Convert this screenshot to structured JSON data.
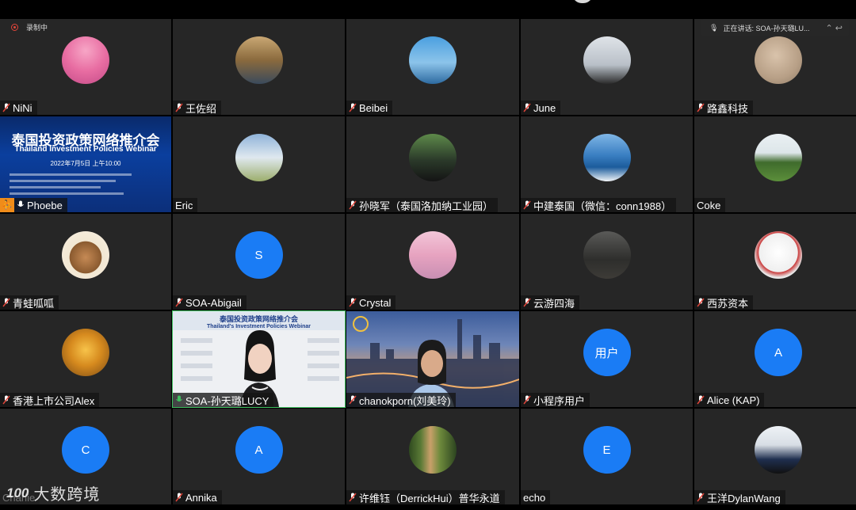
{
  "recording": {
    "label": "录制中"
  },
  "speaking": {
    "label": "正在讲话: SOA-孙天璐LU..."
  },
  "watermark": {
    "logo": "100",
    "text": "大数跨境"
  },
  "poster": {
    "title": "泰国投资政策网络推介会",
    "subtitle": "Thailand Investment Policies Webinar",
    "date": "2022年7月5日  上午10:00"
  },
  "lucy_video": {
    "title": "泰国投资政策网络推介会",
    "subtitle": "Thailand's Investment Policies Webinar"
  },
  "participants": [
    {
      "name": "NiNi"
    },
    {
      "name": "王佐绍"
    },
    {
      "name": "Beibei"
    },
    {
      "name": "June"
    },
    {
      "name": "路鑫科技"
    },
    {
      "name": "Phoebe"
    },
    {
      "name": "Eric"
    },
    {
      "name": "孙晓军（泰国洛加纳工业园）"
    },
    {
      "name": "中建泰国（微信：conn1988）"
    },
    {
      "name": "Coke"
    },
    {
      "name": "青蛙呱呱"
    },
    {
      "name": "SOA-Abigail",
      "initial": "S"
    },
    {
      "name": "Crystal"
    },
    {
      "name": "云游四海"
    },
    {
      "name": "西苏资本"
    },
    {
      "name": "香港上市公司Alex"
    },
    {
      "name": "SOA-孙天璐LUCY"
    },
    {
      "name": "chanokporn(刘美玲)"
    },
    {
      "name": "小程序用户",
      "initial": "用户"
    },
    {
      "name": "Alice (KAP)",
      "initial": "A"
    },
    {
      "name": "Charlie",
      "initial": "C"
    },
    {
      "name": "Annika",
      "initial": "A"
    },
    {
      "name": "许维钰（DerrickHui）普华永道"
    },
    {
      "name": "echo",
      "initial": "E"
    },
    {
      "name": "王洋DylanWang"
    }
  ]
}
